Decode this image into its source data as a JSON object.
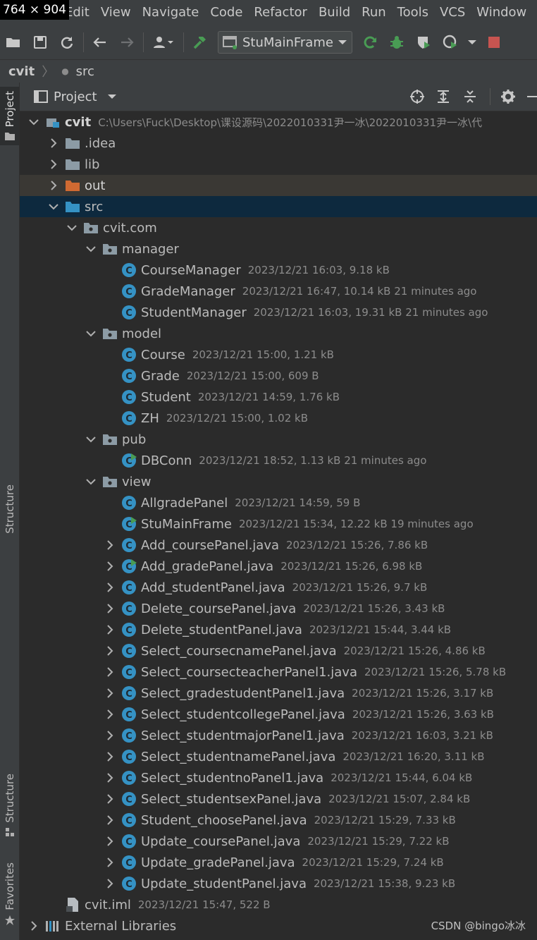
{
  "overlay": {
    "size_badge": "764 × 904"
  },
  "menu": [
    "Edit",
    "View",
    "Navigate",
    "Code",
    "Refactor",
    "Build",
    "Run",
    "Tools",
    "VCS",
    "Window"
  ],
  "toolbar": {
    "run_config": "StuMainFrame"
  },
  "breadcrumb": {
    "root": "cvit",
    "current": "src"
  },
  "panel": {
    "title": "Project"
  },
  "left_strip": {
    "top": "Project",
    "middle": "Structure",
    "bottom_structure": "Structure",
    "favorites": "Favorites"
  },
  "tree": [
    {
      "name": "cvit",
      "meta": "C:\\Users\\Fuck\\Desktop\\课设源码\\2022010331尹一冰\\2022010331尹一冰\\代",
      "icon": "module-icon",
      "depth": 0,
      "arrow": "down"
    },
    {
      "name": ".idea",
      "meta": "",
      "icon": "folder-icon",
      "depth": 1,
      "arrow": "right"
    },
    {
      "name": "lib",
      "meta": "",
      "icon": "folder-icon",
      "depth": 1,
      "arrow": "right"
    },
    {
      "name": "out",
      "meta": "",
      "icon": "folder-out-icon",
      "depth": 1,
      "arrow": "right",
      "out": true
    },
    {
      "name": "src",
      "meta": "",
      "icon": "folder-src-icon",
      "depth": 1,
      "arrow": "down",
      "selected": true
    },
    {
      "name": "cvit.com",
      "meta": "",
      "icon": "package-icon",
      "depth": 2,
      "arrow": "down"
    },
    {
      "name": "manager",
      "meta": "",
      "icon": "package-icon",
      "depth": 3,
      "arrow": "down"
    },
    {
      "name": "CourseManager",
      "meta": "2023/12/21 16:03, 9.18 kB",
      "icon": "class-icon",
      "depth": 4,
      "arrow": "none"
    },
    {
      "name": "GradeManager",
      "meta": "2023/12/21 16:47, 10.14 kB 21 minutes ago",
      "icon": "class-icon",
      "depth": 4,
      "arrow": "none"
    },
    {
      "name": "StudentManager",
      "meta": "2023/12/21 16:03, 19.31 kB 21 minutes ago",
      "icon": "class-icon",
      "depth": 4,
      "arrow": "none"
    },
    {
      "name": "model",
      "meta": "",
      "icon": "package-icon",
      "depth": 3,
      "arrow": "down"
    },
    {
      "name": "Course",
      "meta": "2023/12/21 15:00, 1.21 kB",
      "icon": "class-icon",
      "depth": 4,
      "arrow": "none"
    },
    {
      "name": "Grade",
      "meta": "2023/12/21 15:00, 609 B",
      "icon": "class-icon",
      "depth": 4,
      "arrow": "none"
    },
    {
      "name": "Student",
      "meta": "2023/12/21 14:59, 1.76 kB",
      "icon": "class-icon",
      "depth": 4,
      "arrow": "none"
    },
    {
      "name": "ZH",
      "meta": "2023/12/21 15:00, 1.02 kB",
      "icon": "class-icon",
      "depth": 4,
      "arrow": "none"
    },
    {
      "name": "pub",
      "meta": "",
      "icon": "package-icon",
      "depth": 3,
      "arrow": "down"
    },
    {
      "name": "DBConn",
      "meta": "2023/12/21 18:52, 1.13 kB 21 minutes ago",
      "icon": "class-run-icon",
      "depth": 4,
      "arrow": "none"
    },
    {
      "name": "view",
      "meta": "",
      "icon": "package-icon",
      "depth": 3,
      "arrow": "down"
    },
    {
      "name": "AllgradePanel",
      "meta": "2023/12/21 14:59, 59 B",
      "icon": "class-icon",
      "depth": 4,
      "arrow": "none"
    },
    {
      "name": "StuMainFrame",
      "meta": "2023/12/21 15:34, 12.22 kB 19 minutes ago",
      "icon": "class-run-icon",
      "depth": 4,
      "arrow": "none"
    },
    {
      "name": "Add_coursePanel.java",
      "meta": "2023/12/21 15:26, 7.86 kB",
      "icon": "class-icon",
      "depth": 4,
      "arrow": "right"
    },
    {
      "name": "Add_gradePanel.java",
      "meta": "2023/12/21 15:26, 6.98 kB",
      "icon": "class-run-icon",
      "depth": 4,
      "arrow": "right"
    },
    {
      "name": "Add_studentPanel.java",
      "meta": "2023/12/21 15:26, 9.7 kB",
      "icon": "class-icon",
      "depth": 4,
      "arrow": "right"
    },
    {
      "name": "Delete_coursePanel.java",
      "meta": "2023/12/21 15:26, 3.43 kB",
      "icon": "class-icon",
      "depth": 4,
      "arrow": "right"
    },
    {
      "name": "Delete_studentPanel.java",
      "meta": "2023/12/21 15:44, 3.44 kB",
      "icon": "class-icon",
      "depth": 4,
      "arrow": "right"
    },
    {
      "name": "Select_coursecnamePanel.java",
      "meta": "2023/12/21 15:26, 4.86 kB",
      "icon": "class-icon",
      "depth": 4,
      "arrow": "right"
    },
    {
      "name": "Select_coursecteacherPanel1.java",
      "meta": "2023/12/21 15:26, 5.78 kB",
      "icon": "class-icon",
      "depth": 4,
      "arrow": "right"
    },
    {
      "name": "Select_gradestudentPanel1.java",
      "meta": "2023/12/21 15:26, 3.17 kB",
      "icon": "class-icon",
      "depth": 4,
      "arrow": "right"
    },
    {
      "name": "Select_studentcollegePanel.java",
      "meta": "2023/12/21 15:26, 3.63 kB",
      "icon": "class-icon",
      "depth": 4,
      "arrow": "right"
    },
    {
      "name": "Select_studentmajorPanel1.java",
      "meta": "2023/12/21 16:03, 3.21 kB",
      "icon": "class-icon",
      "depth": 4,
      "arrow": "right"
    },
    {
      "name": "Select_studentnamePanel.java",
      "meta": "2023/12/21 16:20, 3.11 kB",
      "icon": "class-icon",
      "depth": 4,
      "arrow": "right"
    },
    {
      "name": "Select_studentnoPanel1.java",
      "meta": "2023/12/21 15:44, 6.04 kB",
      "icon": "class-icon",
      "depth": 4,
      "arrow": "right"
    },
    {
      "name": "Select_studentsexPanel.java",
      "meta": "2023/12/21 15:07, 2.84 kB",
      "icon": "class-icon",
      "depth": 4,
      "arrow": "right"
    },
    {
      "name": "Student_choosePanel.java",
      "meta": "2023/12/21 15:29, 7.33 kB",
      "icon": "class-icon",
      "depth": 4,
      "arrow": "right"
    },
    {
      "name": "Update_coursePanel.java",
      "meta": "2023/12/21 15:29, 7.22 kB",
      "icon": "class-icon",
      "depth": 4,
      "arrow": "right"
    },
    {
      "name": "Update_gradePanel.java",
      "meta": "2023/12/21 15:29, 7.24 kB",
      "icon": "class-icon",
      "depth": 4,
      "arrow": "right"
    },
    {
      "name": "Update_studentPanel.java",
      "meta": "2023/12/21 15:38, 9.23 kB",
      "icon": "class-icon",
      "depth": 4,
      "arrow": "right"
    },
    {
      "name": "cvit.iml",
      "meta": "2023/12/21 15:47, 522 B",
      "icon": "iml-file-icon",
      "depth": 1,
      "arrow": "none"
    },
    {
      "name": "External Libraries",
      "meta": "",
      "icon": "library-icon",
      "depth": 0,
      "arrow": "right"
    }
  ],
  "watermark": "CSDN @bingo冰冰",
  "colors": {
    "background": "#2b2b2b",
    "panel": "#3c3f41",
    "selection": "#0d293e",
    "class_icon": "#3592c4",
    "folder": "#8c9ba5",
    "folder_out": "#d06a32",
    "folder_src": "#3592c4",
    "run_green": "#499c54",
    "stop_red": "#c75450"
  }
}
